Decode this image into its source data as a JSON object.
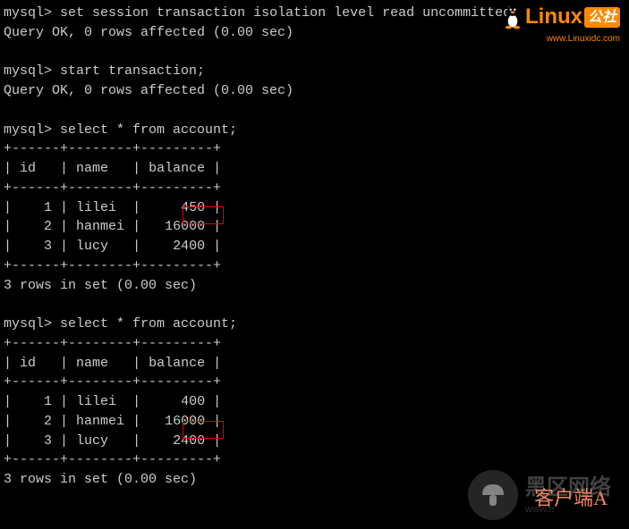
{
  "prompt": "mysql>",
  "cmd1": "set session transaction isolation level read uncommitted;",
  "result1": "Query OK, 0 rows affected (0.00 sec)",
  "cmd2": "start transaction;",
  "result2": "Query OK, 0 rows affected (0.00 sec)",
  "cmd3": "select * from account;",
  "table_border": "+------+--------+---------+",
  "headers": {
    "col1": "id",
    "col2": "name",
    "col3": "balance"
  },
  "query1_rows": [
    {
      "id": "1",
      "name": "lilei",
      "balance": "450"
    },
    {
      "id": "2",
      "name": "hanmei",
      "balance": "16000"
    },
    {
      "id": "3",
      "name": "lucy",
      "balance": "2400"
    }
  ],
  "query1_footer": "3 rows in set (0.00 sec)",
  "cmd4": "select * from account;",
  "query2_rows": [
    {
      "id": "1",
      "name": "lilei",
      "balance": "400"
    },
    {
      "id": "2",
      "name": "hanmei",
      "balance": "16000"
    },
    {
      "id": "3",
      "name": "lucy",
      "balance": "2400"
    }
  ],
  "query2_footer": "3 rows in set (0.00 sec)",
  "logo": {
    "brand_main": "Linux",
    "brand_suffix": "公社",
    "url": "www.Linuxidc.com"
  },
  "watermark": {
    "main": "黑区网络",
    "sub": "www.h",
    "client": "客户端A"
  }
}
